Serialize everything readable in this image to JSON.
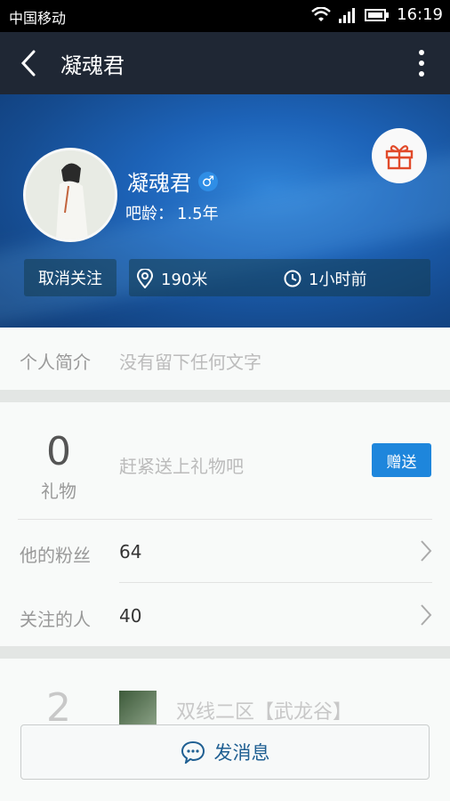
{
  "status_bar": {
    "carrier": "中国移动",
    "time": "16:19"
  },
  "header": {
    "title": "凝魂君"
  },
  "profile": {
    "name": "凝魂君",
    "bar_age_label": "吧龄：",
    "bar_age_value": "1.5年",
    "unfollow_label": "取消关注",
    "distance": "190米",
    "last_seen": "1小时前"
  },
  "bio": {
    "label": "个人简介",
    "value": "没有留下任何文字"
  },
  "gifts": {
    "count": "0",
    "label": "礼物",
    "hint": "赶紧送上礼物吧",
    "send_label": "赠送"
  },
  "stats": [
    {
      "label": "他的粉丝",
      "value": "64"
    },
    {
      "label": "关注的人",
      "value": "40"
    }
  ],
  "forums": {
    "count": "2",
    "name": "双线二区【武龙谷】"
  },
  "message_bar": {
    "label": "发消息"
  },
  "colors": {
    "accent": "#1e86dc",
    "header_bg": "#1f2734",
    "gift_icon": "#e14a2a"
  }
}
